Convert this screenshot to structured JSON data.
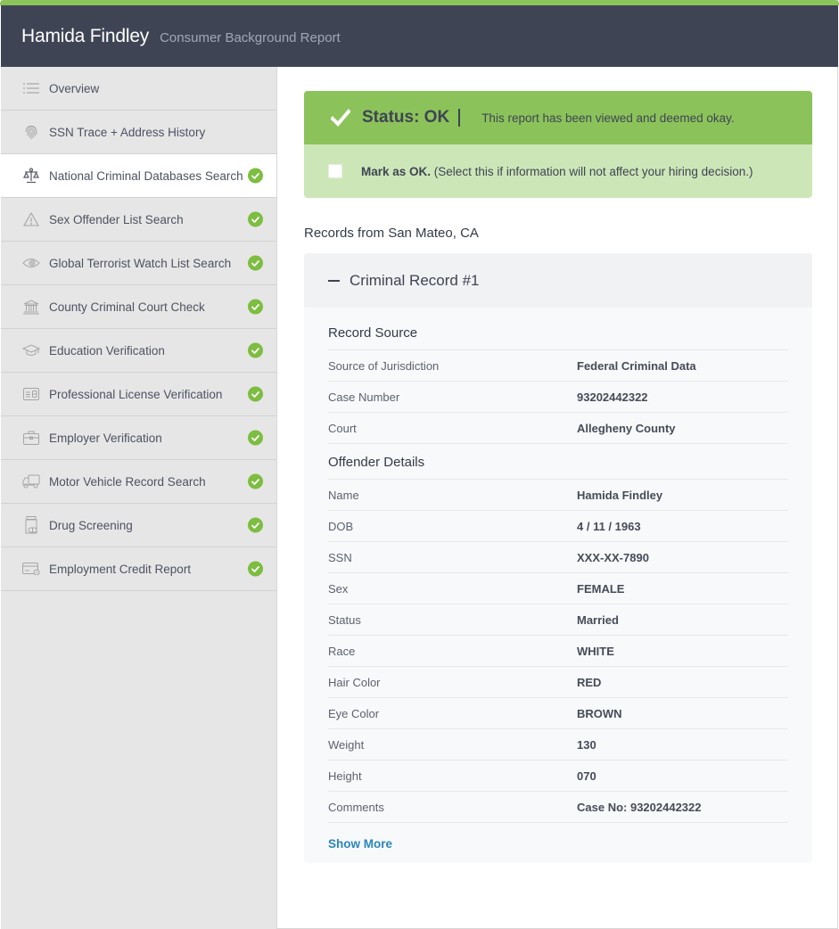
{
  "header": {
    "name": "Hamida Findley",
    "subtitle": "Consumer Background Report"
  },
  "colors": {
    "accent_green": "#8bc35a",
    "check_green": "#7dbd41",
    "header_bg": "#3f4455",
    "link_blue": "#2a86b9"
  },
  "sidebar": {
    "items": [
      {
        "label": "Overview",
        "icon": "list-icon",
        "checked": false,
        "active": false
      },
      {
        "label": "SSN Trace + Address History",
        "icon": "fingerprint-icon",
        "checked": false,
        "active": false
      },
      {
        "label": "National Criminal Databases Search",
        "icon": "scales-icon",
        "checked": true,
        "active": true
      },
      {
        "label": "Sex Offender List Search",
        "icon": "warning-icon",
        "checked": true,
        "active": false
      },
      {
        "label": "Global Terrorist Watch List Search",
        "icon": "eye-icon",
        "checked": true,
        "active": false
      },
      {
        "label": "County Criminal Court Check",
        "icon": "courthouse-icon",
        "checked": true,
        "active": false
      },
      {
        "label": "Education Verification",
        "icon": "graduation-cap-icon",
        "checked": true,
        "active": false
      },
      {
        "label": "Professional License Verification",
        "icon": "id-card-icon",
        "checked": true,
        "active": false
      },
      {
        "label": "Employer Verification",
        "icon": "briefcase-icon",
        "checked": true,
        "active": false
      },
      {
        "label": "Motor Vehicle Record Search",
        "icon": "truck-icon",
        "checked": true,
        "active": false
      },
      {
        "label": "Drug Screening",
        "icon": "pill-bottle-icon",
        "checked": true,
        "active": false
      },
      {
        "label": "Employment Credit Report",
        "icon": "credit-card-icon",
        "checked": true,
        "active": false
      }
    ]
  },
  "status": {
    "icon": "checkmark-icon",
    "title": "Status: OK",
    "message": "This report has been viewed and deemed okay.",
    "mark_ok_bold": "Mark as OK.",
    "mark_ok_text": " (Select this if information will not affect your hiring decision.)",
    "mark_ok_checked": false
  },
  "records": {
    "heading": "Records from San Mateo, CA",
    "record": {
      "title": "Criminal Record #1",
      "expanded": true,
      "source_section": {
        "title": "Record Source",
        "rows": [
          {
            "label": "Source of Jurisdiction",
            "value": "Federal Criminal Data"
          },
          {
            "label": "Case Number",
            "value": "93202442322"
          },
          {
            "label": "Court",
            "value": "Allegheny County"
          }
        ]
      },
      "offender_section": {
        "title": "Offender Details",
        "rows": [
          {
            "label": "Name",
            "value": "Hamida Findley"
          },
          {
            "label": "DOB",
            "value": "4 / 11 / 1963"
          },
          {
            "label": "SSN",
            "value": "XXX-XX-7890"
          },
          {
            "label": "Sex",
            "value": "FEMALE"
          },
          {
            "label": "Status",
            "value": "Married"
          },
          {
            "label": "Race",
            "value": "WHITE"
          },
          {
            "label": "Hair Color",
            "value": "RED"
          },
          {
            "label": "Eye Color",
            "value": "BROWN"
          },
          {
            "label": "Weight",
            "value": "130"
          },
          {
            "label": "Height",
            "value": "070"
          },
          {
            "label": "Comments",
            "value": "Case No: 93202442322"
          }
        ]
      },
      "show_more_label": "Show More"
    }
  }
}
